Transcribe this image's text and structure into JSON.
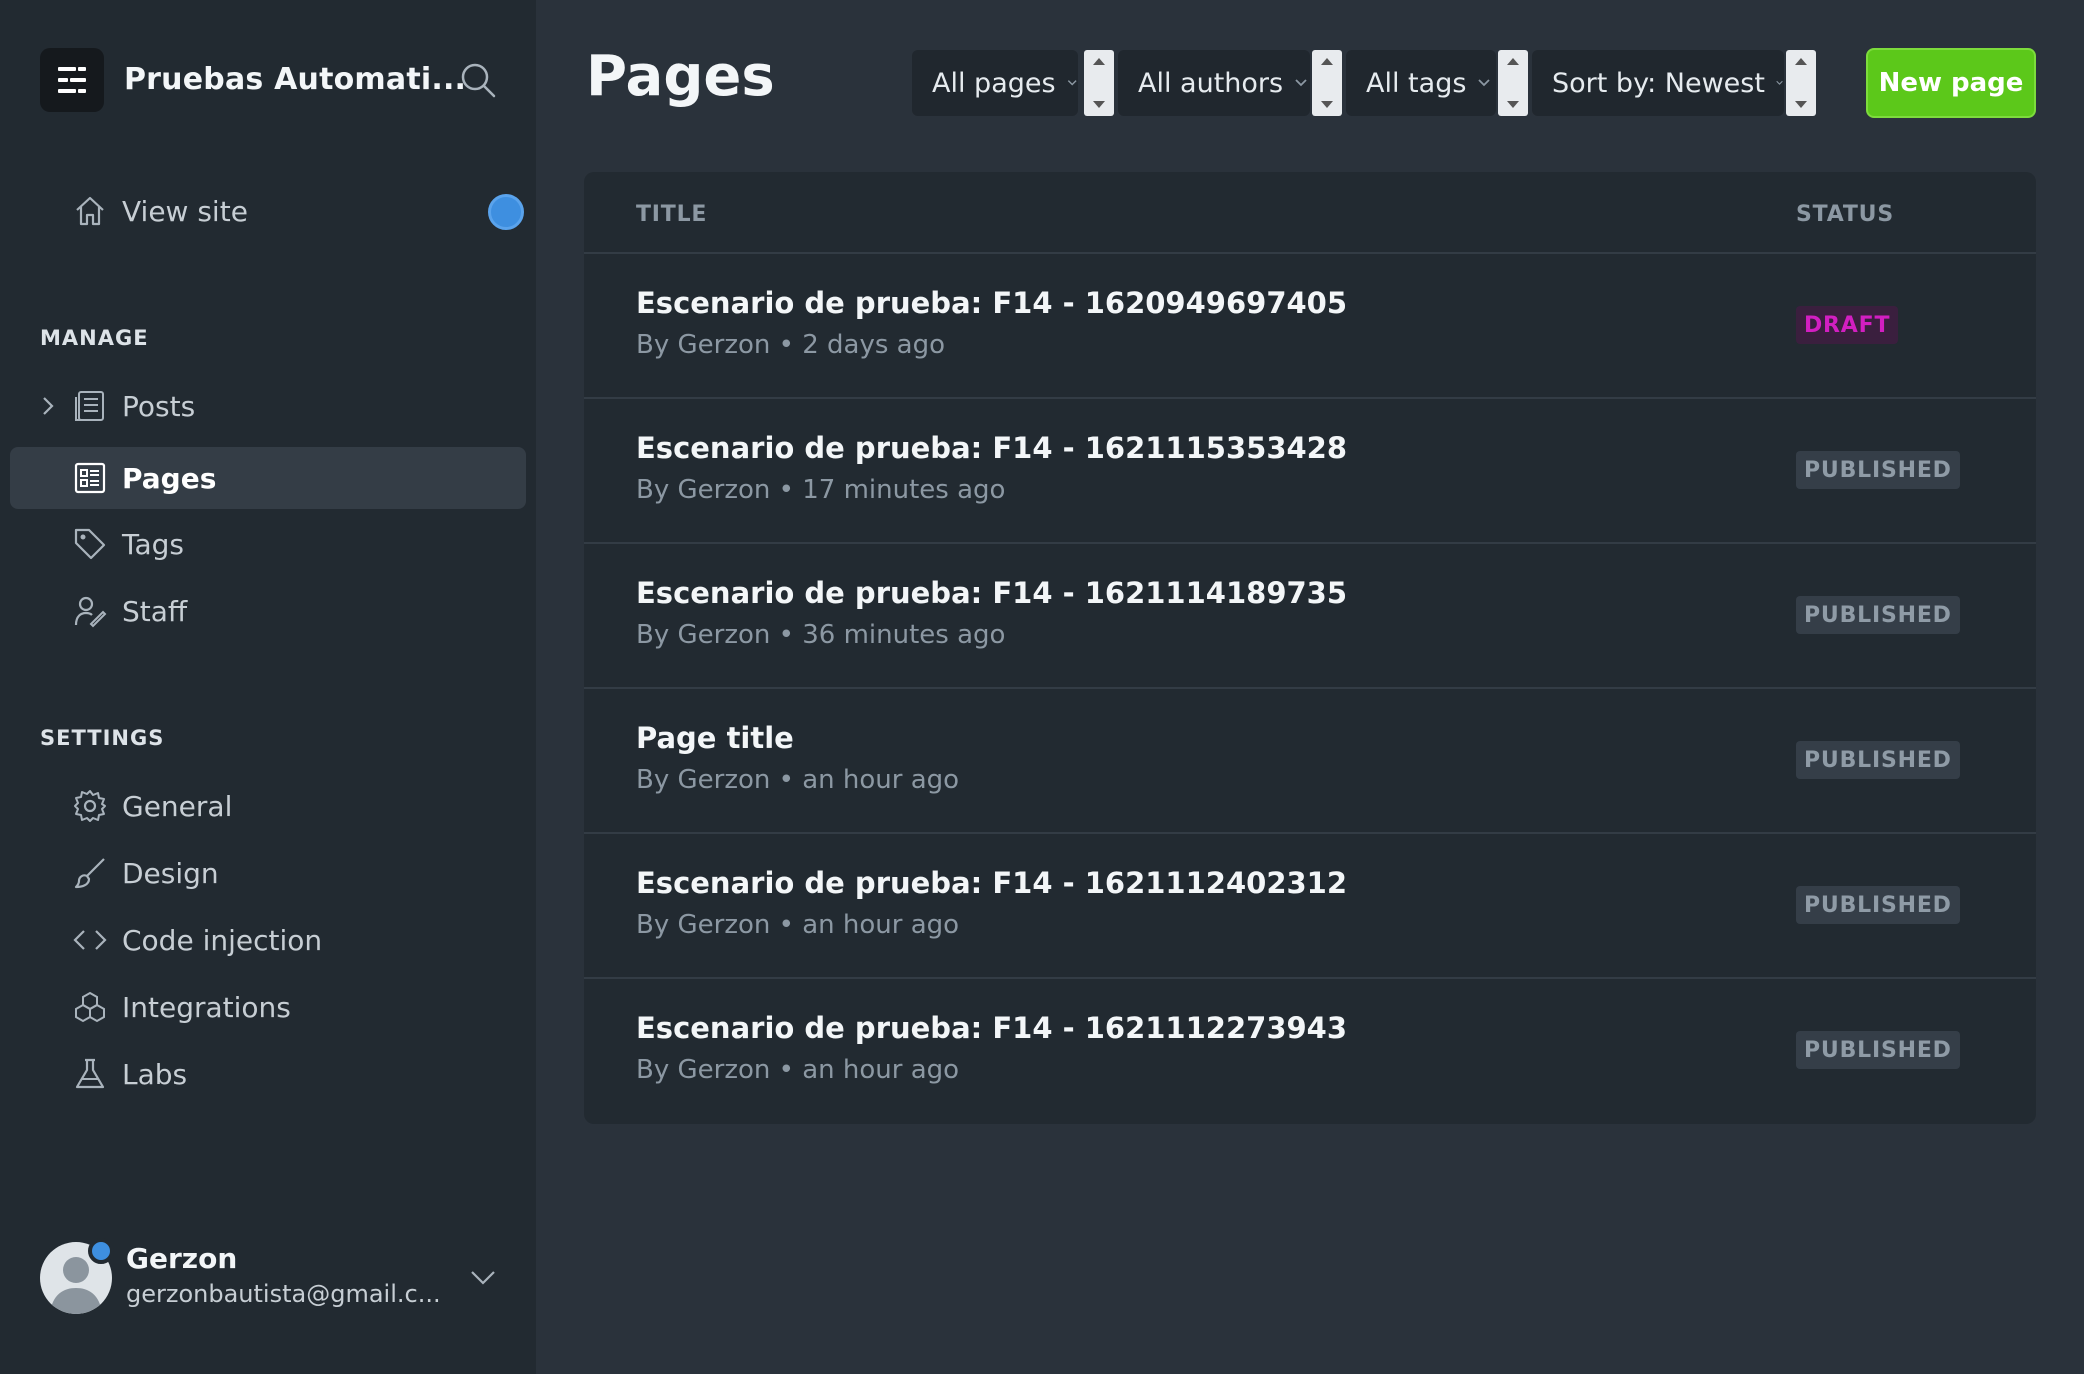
{
  "sidebar": {
    "site_title": "Pruebas Automati...",
    "view_site": "View site",
    "manage_heading": "MANAGE",
    "manage_items": [
      {
        "label": "Posts",
        "icon": "posts-icon"
      },
      {
        "label": "Pages",
        "icon": "pages-icon",
        "active": true
      },
      {
        "label": "Tags",
        "icon": "tag-icon"
      },
      {
        "label": "Staff",
        "icon": "staff-icon"
      }
    ],
    "settings_heading": "SETTINGS",
    "settings_items": [
      {
        "label": "General",
        "icon": "gear-icon"
      },
      {
        "label": "Design",
        "icon": "brush-icon"
      },
      {
        "label": "Code injection",
        "icon": "code-icon"
      },
      {
        "label": "Integrations",
        "icon": "integrations-icon"
      },
      {
        "label": "Labs",
        "icon": "flask-icon"
      }
    ],
    "user": {
      "name": "Gerzon",
      "email": "gerzonbautista@gmail.c..."
    }
  },
  "header": {
    "title": "Pages",
    "filters": [
      {
        "label": "All pages"
      },
      {
        "label": "All authors"
      },
      {
        "label": "All tags"
      },
      {
        "label": "Sort by: Newest"
      }
    ],
    "new_button": "New page"
  },
  "table": {
    "columns": [
      "TITLE",
      "STATUS"
    ],
    "rows": [
      {
        "title": "Escenario de prueba: F14 - 1620949697405",
        "meta": "By Gerzon • 2 days ago",
        "status": "DRAFT"
      },
      {
        "title": "Escenario de prueba: F14 - 1621115353428",
        "meta": "By Gerzon • 17 minutes ago",
        "status": "PUBLISHED"
      },
      {
        "title": "Escenario de prueba: F14 - 1621114189735",
        "meta": "By Gerzon • 36 minutes ago",
        "status": "PUBLISHED"
      },
      {
        "title": "Page title",
        "meta": "By Gerzon • an hour ago",
        "status": "PUBLISHED"
      },
      {
        "title": "Escenario de prueba: F14 - 1621112402312",
        "meta": "By Gerzon • an hour ago",
        "status": "PUBLISHED"
      },
      {
        "title": "Escenario de prueba: F14 - 1621112273943",
        "meta": "By Gerzon • an hour ago",
        "status": "PUBLISHED"
      }
    ]
  },
  "colors": {
    "accent_green": "#5cc81a",
    "draft_pink": "#d21fc1",
    "notification_blue": "#3e8fe0"
  }
}
